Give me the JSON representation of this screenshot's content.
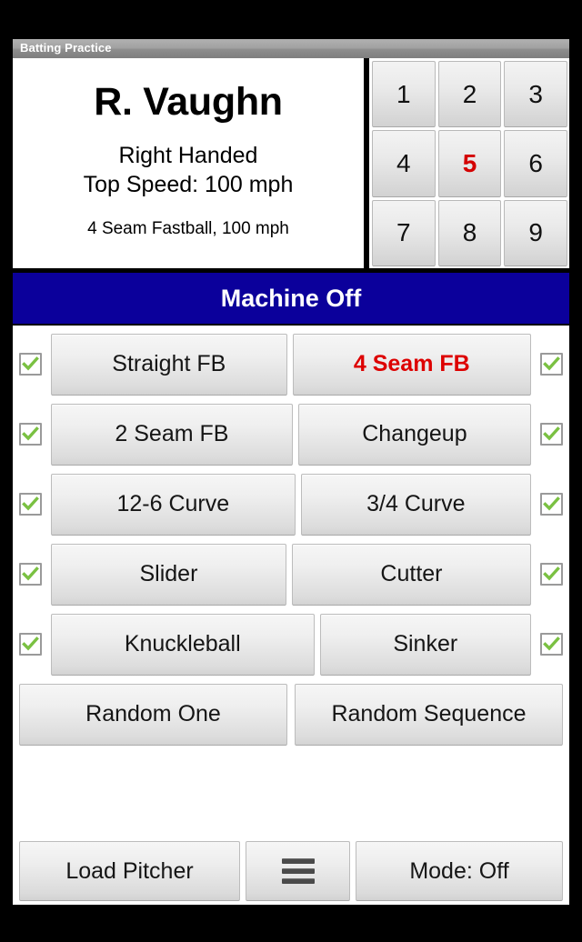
{
  "window": {
    "title": "Batting Practice"
  },
  "pitcher": {
    "name": "R. Vaughn",
    "handedness": "Right Handed",
    "top_speed": "Top Speed: 100 mph",
    "current_pitch": "4 Seam Fastball, 100 mph"
  },
  "keypad": {
    "keys": [
      {
        "label": "1",
        "selected": false
      },
      {
        "label": "2",
        "selected": false
      },
      {
        "label": "3",
        "selected": false
      },
      {
        "label": "4",
        "selected": false
      },
      {
        "label": "5",
        "selected": true
      },
      {
        "label": "6",
        "selected": false
      },
      {
        "label": "7",
        "selected": false
      },
      {
        "label": "8",
        "selected": false
      },
      {
        "label": "9",
        "selected": false
      }
    ],
    "selected_value": "5"
  },
  "status": {
    "label": "Machine Off",
    "background_color": "#0b009b",
    "text_color": "#ffffff"
  },
  "pitches": {
    "rows": [
      {
        "left": {
          "label": "Straight FB",
          "checked": true,
          "selected": false
        },
        "right": {
          "label": "4 Seam FB",
          "checked": true,
          "selected": true
        }
      },
      {
        "left": {
          "label": "2 Seam FB",
          "checked": true,
          "selected": false
        },
        "right": {
          "label": "Changeup",
          "checked": true,
          "selected": false
        }
      },
      {
        "left": {
          "label": "12-6 Curve",
          "checked": true,
          "selected": false
        },
        "right": {
          "label": "3/4 Curve",
          "checked": true,
          "selected": false
        }
      },
      {
        "left": {
          "label": "Slider",
          "checked": true,
          "selected": false
        },
        "right": {
          "label": "Cutter",
          "checked": true,
          "selected": false
        }
      },
      {
        "left": {
          "label": "Knuckleball",
          "checked": true,
          "selected": false
        },
        "right": {
          "label": "Sinker",
          "checked": true,
          "selected": false
        }
      }
    ],
    "random_one": "Random One",
    "random_sequence": "Random Sequence",
    "selected_color": "#dd0000",
    "checkbox_color": "#7ac142"
  },
  "bottom_bar": {
    "load_pitcher": "Load Pitcher",
    "menu_icon": "hamburger-menu-icon",
    "mode": "Mode: Off"
  }
}
